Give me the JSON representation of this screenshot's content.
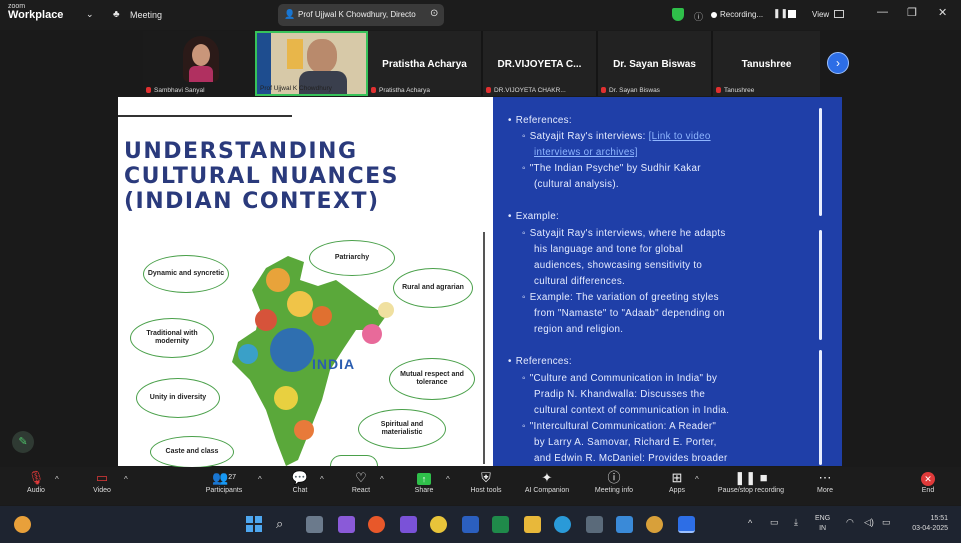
{
  "app": {
    "brand_top": "zoom",
    "brand_main": "Workplace",
    "meeting_label": "Meeting",
    "presenter_label": "Prof Ujjwal K Chowdhury, Directo",
    "recording_label": "Recording...",
    "view_label": "View"
  },
  "gallery": {
    "tiles": [
      {
        "caption": "Sambhavi Sanyal"
      },
      {
        "caption": "Prof Ujjwal K Chowdhury"
      },
      {
        "name": "Pratistha Acharya",
        "caption": "Pratistha Acharya"
      },
      {
        "name": "DR.VIJOYETA C...",
        "caption": "DR.VIJOYETA CHAKR..."
      },
      {
        "name": "Dr. Sayan Biswas",
        "caption": "Dr. Sayan Biswas"
      },
      {
        "name": "Tanushree",
        "caption": "Tanushree"
      }
    ]
  },
  "slide": {
    "title_lines": [
      "UNDERSTANDING",
      "CULTURAL NUANCES",
      "(INDIAN CONTEXT)"
    ],
    "map_label": "INDIA",
    "bubbles": [
      "Dynamic and syncretic",
      "Patriarchy",
      "Rural and agrarian",
      "Traditional with modernity",
      "Mutual respect and tolerance",
      "Unity in diversity",
      "Spiritual and materialistic",
      "Caste and class"
    ],
    "right": {
      "s1_head": "References:",
      "s1_i1a": "Satyajit Ray's interviews:",
      "s1_i1_link": "[Link to video",
      "s1_i1_link2": "interviews or archives]",
      "s1_i2a": "\"The Indian Psyche\" by Sudhir Kakar",
      "s1_i2b": "(cultural analysis).",
      "s2_head": "Example:",
      "s2_i1": [
        "Satyajit Ray's interviews, where he adapts",
        "his language and tone for global",
        "audiences, showcasing sensitivity to",
        "cultural differences."
      ],
      "s2_i2": [
        "Example: The variation of greeting styles",
        "from \"Namaste\" to \"Adaab\" depending on",
        "region and religion."
      ],
      "s3_head": "References:",
      "s3_i1": [
        "\"Culture and Communication in India\" by",
        "Pradip N. Khandwalla: Discusses the",
        "cultural context of communication in India."
      ],
      "s3_i2": [
        "\"Intercultural Communication: A Reader\"",
        "by Larry A. Samovar, Richard E. Porter,",
        "and Edwin R. McDaniel: Provides broader"
      ]
    }
  },
  "toolbar": {
    "audio": "Audio",
    "video": "Video",
    "participants": "Participants",
    "participants_count": "27",
    "chat": "Chat",
    "react": "React",
    "share": "Share",
    "host_tools": "Host tools",
    "ai_companion": "AI Companion",
    "meeting_info": "Meeting info",
    "apps": "Apps",
    "pause_rec": "Pause/stop recording",
    "more": "More",
    "end": "End"
  },
  "taskbar": {
    "lang1": "ENG",
    "lang2": "IN",
    "time": "15:51",
    "date": "03-04-2025"
  },
  "colors": {
    "slide_blue": "#1f3fa8",
    "title_navy": "#2a3a7c",
    "accent_green": "#4aa04a"
  }
}
